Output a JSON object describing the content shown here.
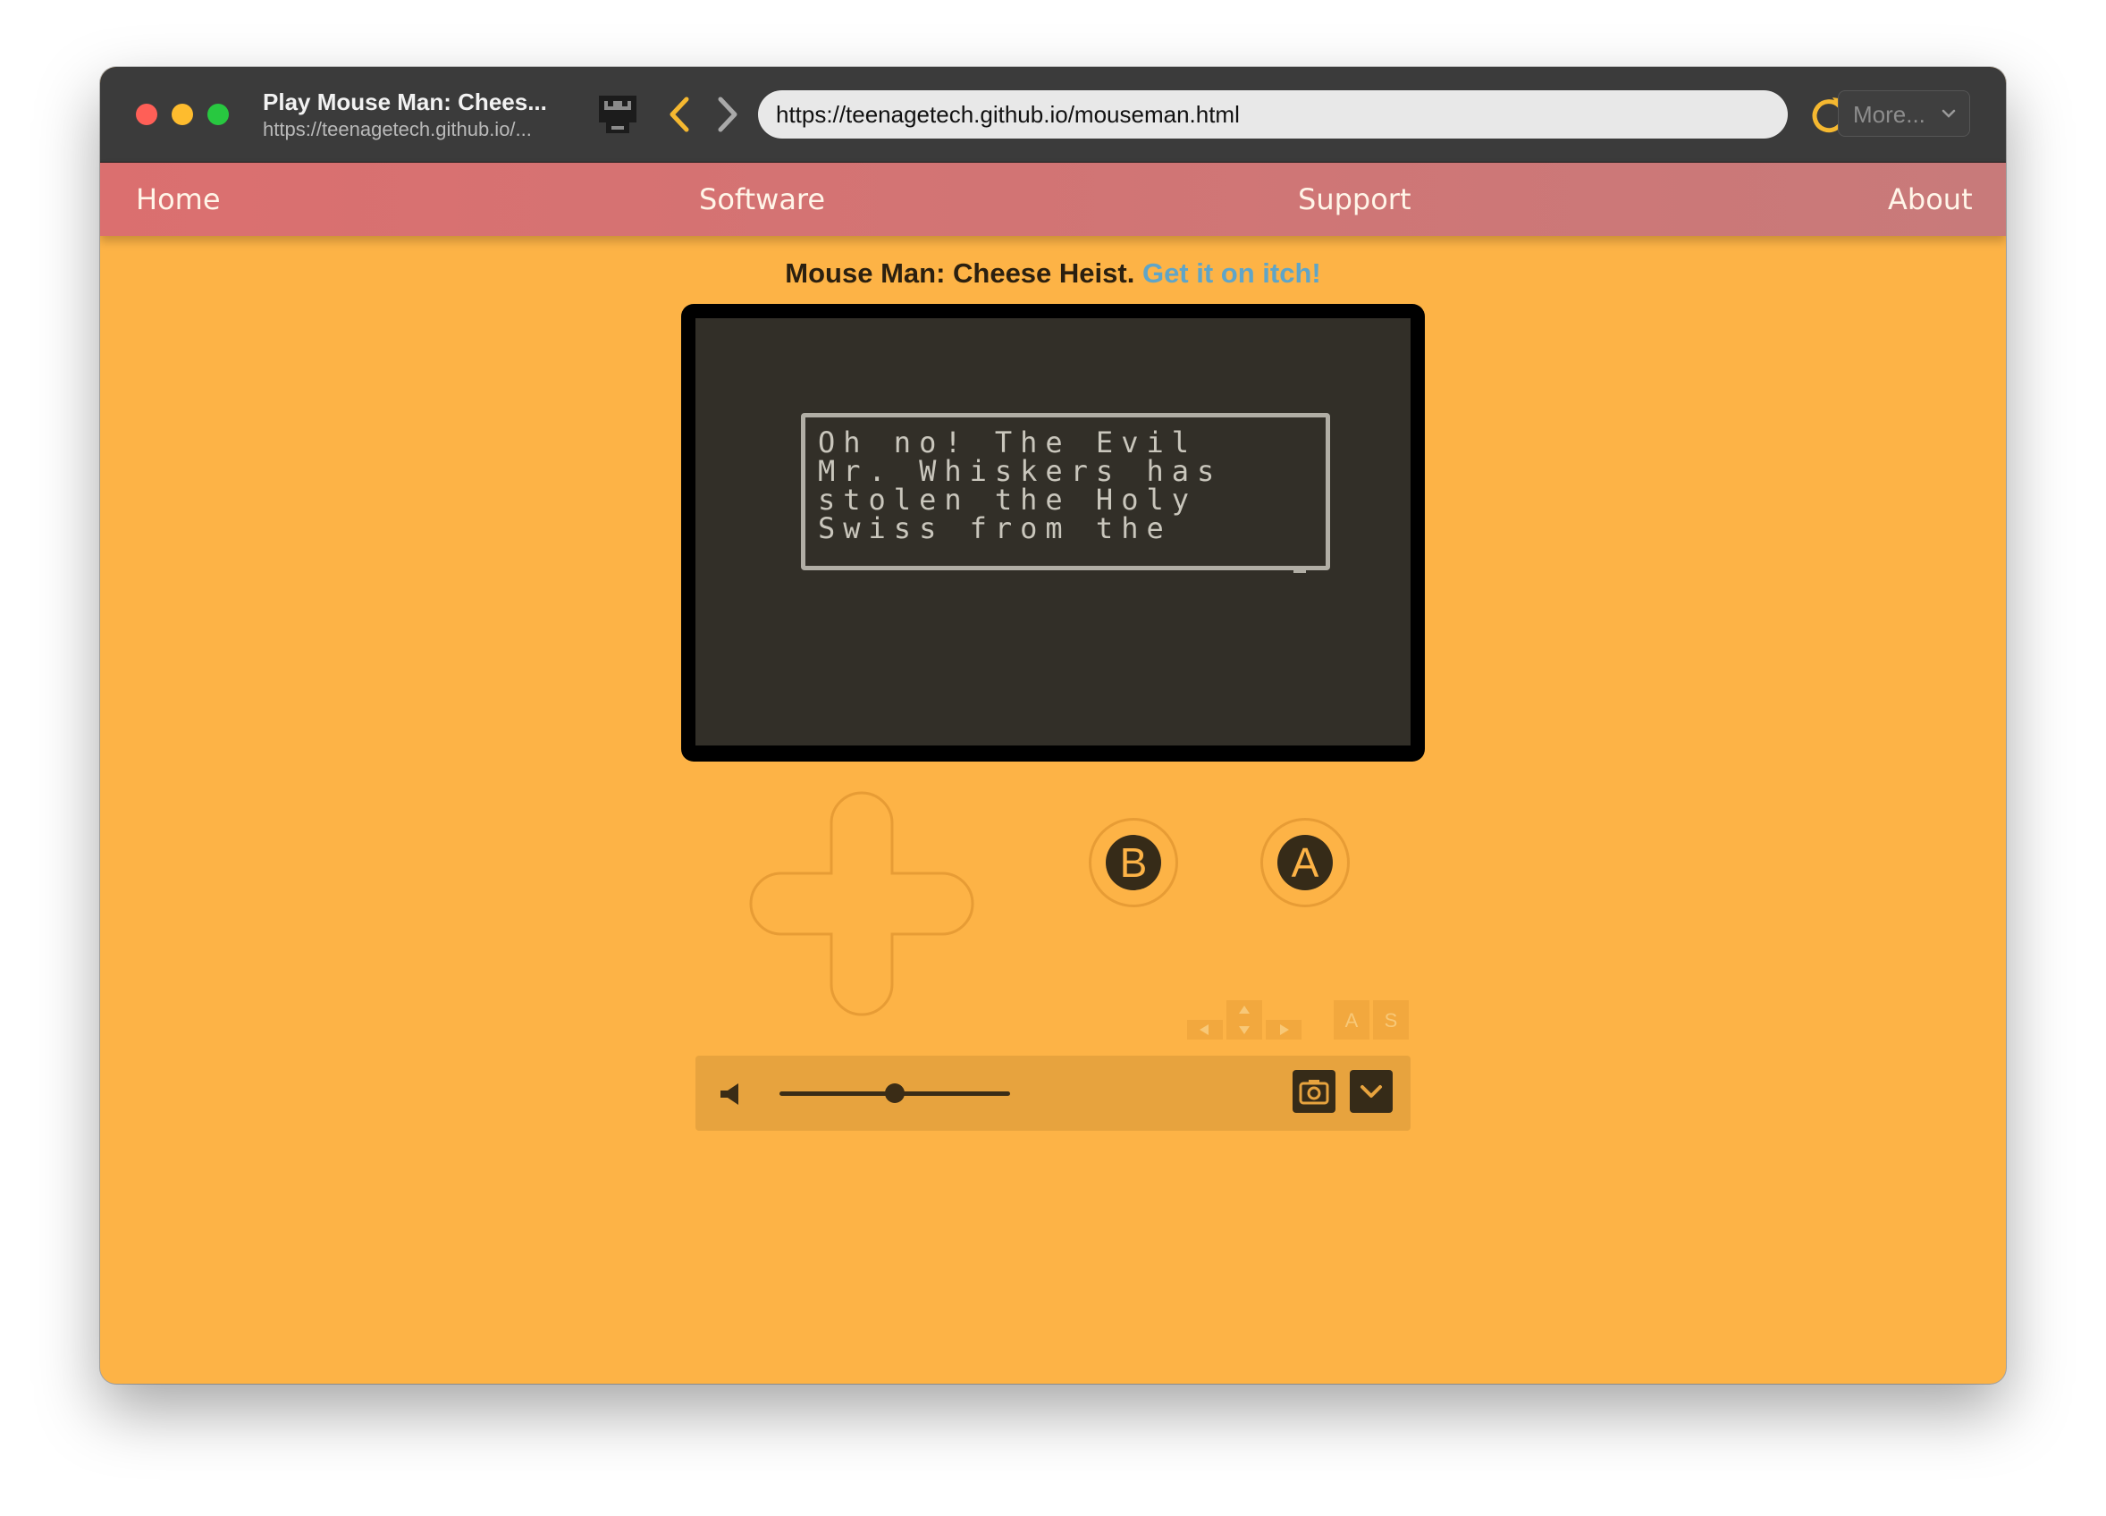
{
  "browser": {
    "tab_title": "Play Mouse Man: Chees...",
    "tab_url": "https://teenagetech.github.io/...",
    "address": "https://teenagetech.github.io/mouseman.html",
    "more_label": "More...",
    "icons": [
      "site-favicon-icon",
      "back-icon",
      "forward-icon",
      "reload-icon",
      "zoom-in-icon",
      "chevron-down-icon"
    ]
  },
  "nav": {
    "items": [
      {
        "label": "Home"
      },
      {
        "label": "Software"
      },
      {
        "label": "Support"
      },
      {
        "label": "About"
      }
    ]
  },
  "page": {
    "title": "Mouse Man: Cheese Heist.",
    "link_text": "Get it on itch!"
  },
  "game": {
    "dialog_text": "Oh no! The Evil\nMr. Whiskers has\nstolen the Holy\nSwiss from the",
    "buttons": {
      "b": "B",
      "a": "A"
    },
    "key_hints": {
      "a": "A",
      "s": "S"
    }
  },
  "controls": {
    "volume_level": 0.5,
    "icons": [
      "volume-icon",
      "camera-icon",
      "chevron-down-icon"
    ]
  },
  "colors": {
    "background": "#fdb346",
    "nav": "#d97171",
    "screen": "#322f28",
    "link": "#5fa5c8"
  }
}
